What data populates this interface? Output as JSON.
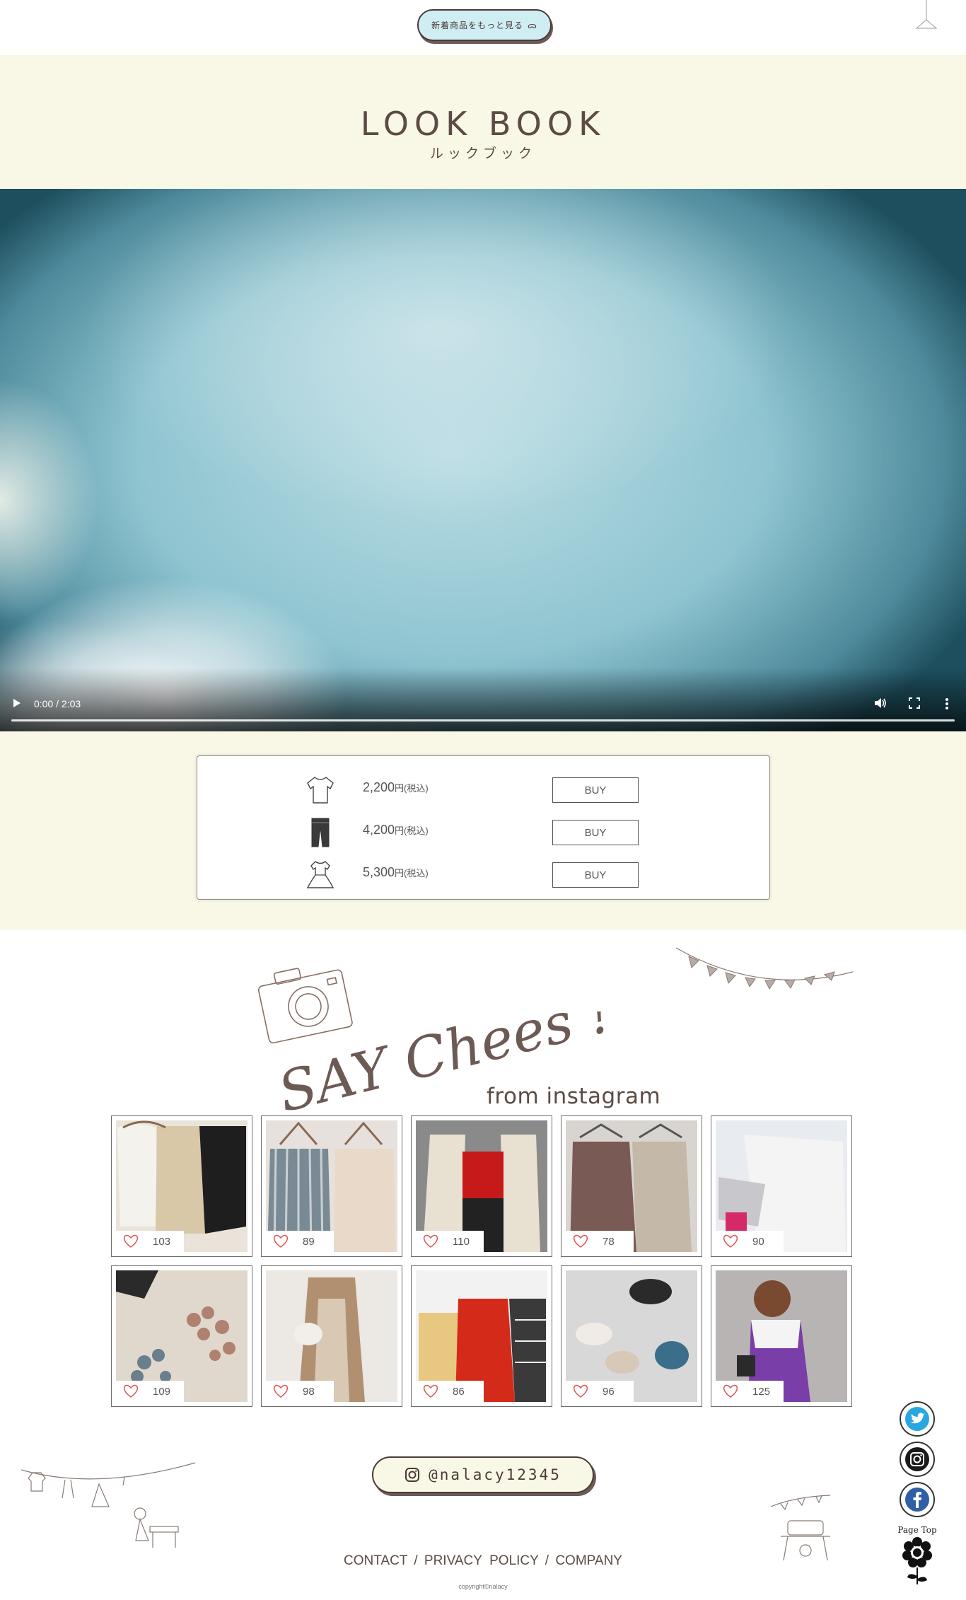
{
  "header": {
    "more_button_label": "新着商品をもっと見る",
    "more_button_glyph": "ᯅ"
  },
  "lookbook": {
    "title": "LOOK BOOK",
    "subtitle": "ルックブック",
    "video": {
      "time": "0:00 / 2:03",
      "progress": 0
    },
    "items": [
      {
        "icon": "tshirt-icon",
        "price": "2,200",
        "unit": "円(税込)",
        "buy_label": "BUY"
      },
      {
        "icon": "pants-icon",
        "price": "4,200",
        "unit": "円(税込)",
        "buy_label": "BUY"
      },
      {
        "icon": "dress-icon",
        "price": "5,300",
        "unit": "円(税込)",
        "buy_label": "BUY"
      }
    ]
  },
  "instagram": {
    "heading": "SAY Chees !",
    "subheading": "from instagram",
    "posts": [
      {
        "likes": "103",
        "palette": [
          "#e9e3d9",
          "#d8c8a8",
          "#1e1e1e"
        ]
      },
      {
        "likes": "89",
        "palette": [
          "#e6e1dc",
          "#7a8a94",
          "#e9d9c9"
        ]
      },
      {
        "likes": "110",
        "palette": [
          "#8a8a8a",
          "#c61a1a",
          "#e8e0d0"
        ]
      },
      {
        "likes": "78",
        "palette": [
          "#d8d4d0",
          "#7a5a54",
          "#c4b8a8"
        ]
      },
      {
        "likes": "90",
        "palette": [
          "#e8ecf0",
          "#f4f4f4",
          "#c8c8cc"
        ]
      },
      {
        "likes": "109",
        "palette": [
          "#e0d8cc",
          "#b08070",
          "#6a7e8c"
        ]
      },
      {
        "likes": "98",
        "palette": [
          "#ece8e4",
          "#b09070",
          "#f2efea"
        ]
      },
      {
        "likes": "86",
        "palette": [
          "#f2f2f2",
          "#d42a1a",
          "#e8c880"
        ]
      },
      {
        "likes": "96",
        "palette": [
          "#d8d8d8",
          "#d8c8b8",
          "#3a3a3a"
        ]
      },
      {
        "likes": "125",
        "palette": [
          "#b8b4b4",
          "#7a3ea8",
          "#2a2a2a"
        ]
      }
    ],
    "account_label": "@nalacy12345"
  },
  "footer": {
    "links": [
      "CONTACT",
      "PRIVACY  POLICY",
      "COMPANY"
    ],
    "separator": "/",
    "copyright": "copyright©nalacy"
  },
  "side": {
    "page_top_label": "Page Top"
  },
  "colors": {
    "cream_bg": "#f9f8e6",
    "button_blue": "#cfeef3",
    "brown_text": "#5d4b45",
    "heart": "#e05a5a"
  }
}
